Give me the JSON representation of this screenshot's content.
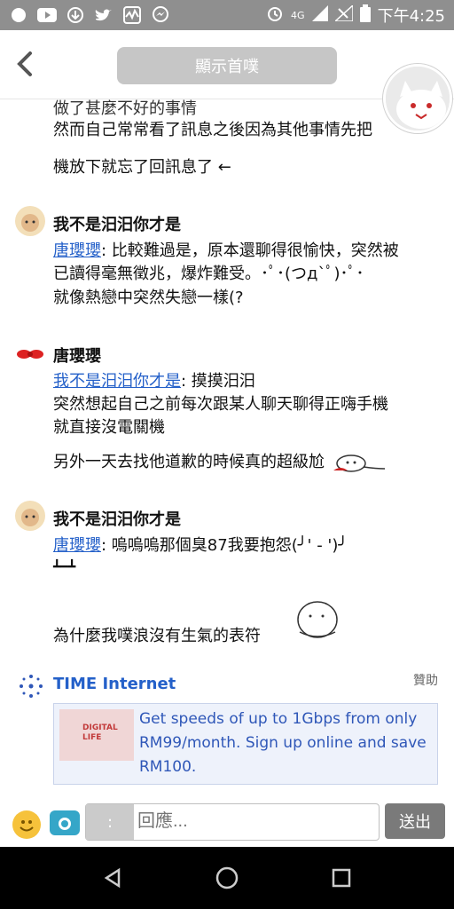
{
  "statusbar": {
    "network": "4G",
    "time": "下午4:25"
  },
  "header": {
    "show_first_label": "顯示首噗"
  },
  "thread": {
    "top_lines": [
      "做了甚麼不好的事情",
      "然而自己常常看了訊息之後因為其他事情先把",
      "機放下就忘了回訊息了"
    ],
    "messages": [
      {
        "author": "我不是汨汨你才是",
        "mention": "唐瓔瓔",
        "lines": [
          ": 比較難過是，原本還聊得很愉快，突然被",
          "已讀得毫無徵兆，爆炸難受。･ﾟ･(つд`ﾟ)･ﾟ･",
          "就像熱戀中突然失戀一樣(?"
        ]
      },
      {
        "author": "唐瓔瓔",
        "mention": "我不是汨汨你才是",
        "lines": [
          ": 摸摸汨汨",
          "突然想起自己之前每次跟某人聊天聊得正嗨手機",
          "就直接沒電關機",
          "另外一天去找他道歉的時候真的超級尬"
        ]
      },
      {
        "author": "我不是汨汨你才是",
        "mention": "唐瓔瓔",
        "lines": [
          ": 嗚嗚嗚那個臭87我要抱怨(╯' - ')╯",
          "┻━┻",
          "為什麼我噗浪沒有生氣的表符"
        ]
      }
    ]
  },
  "ad": {
    "title": "TIME Internet",
    "sponsored": "贊助",
    "image_text": "DIGITAL LIFE",
    "text": "Get speeds of up to 1Gbps from only RM99/month. Sign up online and save RM100."
  },
  "composer": {
    "prefix": ":",
    "placeholder": "回應...",
    "send_label": "送出"
  }
}
